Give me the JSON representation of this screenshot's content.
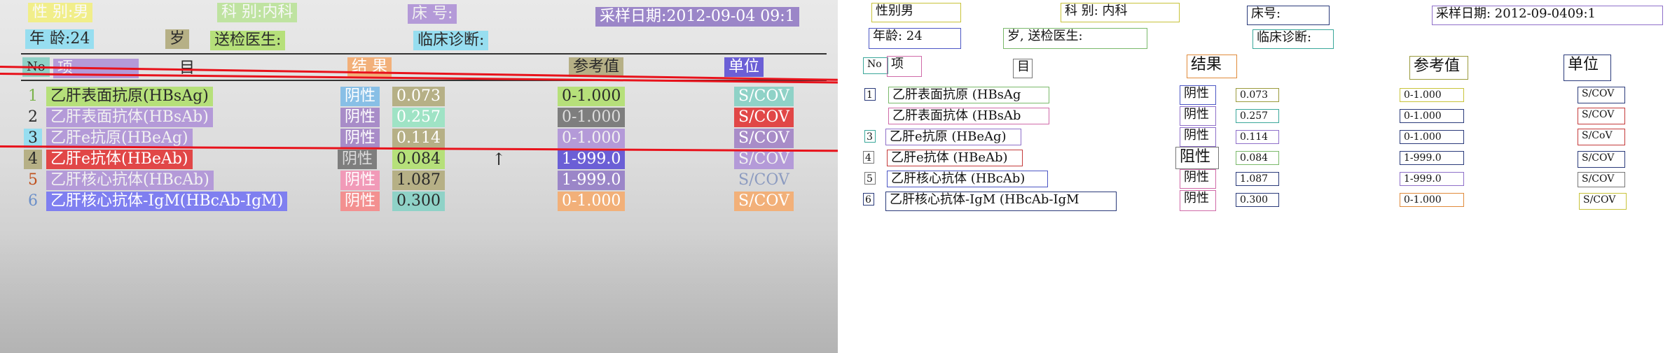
{
  "photo": {
    "gender_label": "性  别:男",
    "dept_label": "科    别:内科",
    "bed_label": "床    号:",
    "sample_date": "采样日期:2012-09-04 09:1",
    "age_label": "年  龄:24",
    "age_suffix": "岁",
    "doctor_label": "送检医生:",
    "diagnosis_label": "临床诊断:",
    "header": {
      "no": "No",
      "item": "项",
      "item2": "目",
      "result": "结  果",
      "reference": "参考值",
      "unit": "单位"
    },
    "rows": [
      {
        "no": "1",
        "name": "乙肝表面抗原(HBsAg)",
        "qual": "阴性",
        "value": "0.073",
        "ref": "0-1.000",
        "unit": "S/COV"
      },
      {
        "no": "2",
        "name": "乙肝表面抗体(HBsAb)",
        "qual": "阴性",
        "value": "0.257",
        "ref": "0-1.000",
        "unit": "S/COV"
      },
      {
        "no": "3",
        "name": "乙肝e抗原(HBeAg)",
        "qual": "阴性",
        "value": "0.114",
        "ref": "0-1.000",
        "unit": "S/COV"
      },
      {
        "no": "4",
        "name": "乙肝e抗体(HBeAb)",
        "qual": "阴性",
        "value": "0.084",
        "ref": "1-999.0",
        "unit": "S/COV"
      },
      {
        "no": "5",
        "name": "乙肝核心抗体(HBcAb)",
        "qual": "阴性",
        "value": "1.087",
        "ref": "1-999.0",
        "unit": "S/COV"
      },
      {
        "no": "6",
        "name": "乙肝核心抗体-IgM(HBcAb-IgM)",
        "qual": "阴性",
        "value": "0.300",
        "ref": "0-1.000",
        "unit": "S/COV"
      }
    ],
    "arrow": "↑"
  },
  "recon": {
    "gender": "性别男",
    "dept": "科     别: 内科",
    "bed": "床号:",
    "sample_date": "采样日期: 2012-09-0409:1",
    "age": "年龄: 24",
    "age_doctor": "岁, 送检医生:",
    "diagnosis": "临床诊断:",
    "no": "No",
    "item": "项",
    "item2": "目",
    "result": "结果",
    "reference": "参考值",
    "unit": "单位",
    "rows": [
      {
        "no": "1",
        "name": "乙肝表面抗原 (HBsAg",
        "qual": "阴性",
        "value": "0.073",
        "ref": "0-1.000",
        "unit": "S/COV"
      },
      {
        "no": "",
        "name": "乙肝表面抗体 (HBsAb",
        "qual": "阴性",
        "value": "0.257",
        "ref": "0-1.000",
        "unit": "S/COV"
      },
      {
        "no": "3",
        "name": "乙肝e抗原 (HBeAg)",
        "qual": "阴性",
        "value": "0.114",
        "ref": "0-1.000",
        "unit": "S/CoV"
      },
      {
        "no": "4",
        "name": "乙肝e抗体 (HBeAb)",
        "qual": "阻性",
        "value": "0.084",
        "ref": "1-999.0",
        "unit": "S/COV"
      },
      {
        "no": "5",
        "name": "乙肝核心抗体 (HBcAb)",
        "qual": "阴性",
        "value": "1.087",
        "ref": "1-999.0",
        "unit": "S/COV"
      },
      {
        "no": "6",
        "name": "乙肝核心抗体-IgM (HBcAb-IgM",
        "qual": "阴性",
        "value": "0.300",
        "ref": "0-1.000",
        "unit": "S/COV"
      }
    ]
  }
}
